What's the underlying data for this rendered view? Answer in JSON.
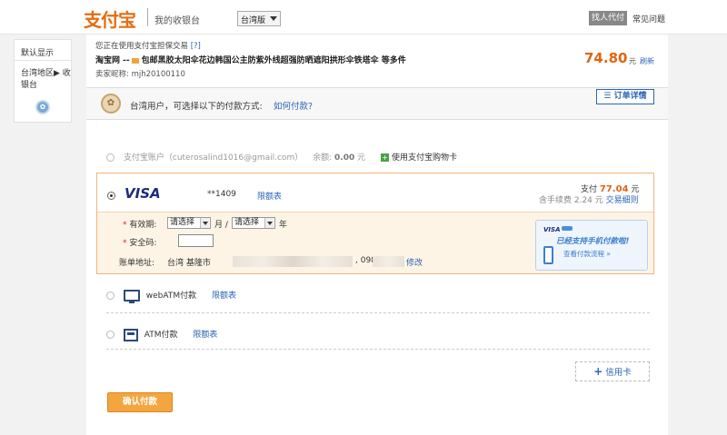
{
  "header": {
    "logo": "支付宝",
    "cashier_title": "我的收银台",
    "region": "台湾版",
    "find_pay": "找人代付",
    "faq": "常见问题"
  },
  "sidebar": {
    "title": "默认显示",
    "region_label": "台湾地区▶ 收银台"
  },
  "order": {
    "guarantee_notice": "您正在使用支付宝担保交易",
    "guarantee_q": "[?]",
    "site": "淘宝网 --",
    "title": "包邮黑胶太阳伞花边韩国公主防紫外线超强防晒遮阳拱形伞铁塔伞  等多件",
    "seller_label": "卖家昵称: ",
    "seller_name": "mjh20100110",
    "amount": "74.80",
    "amount_unit": "元",
    "refresh": "刷新"
  },
  "tip": {
    "text": "台湾用户，可选择以下的付款方式:",
    "link": "如何付款?",
    "order_detail": "订单详情"
  },
  "alipay_account": {
    "label": "支付宝账户（cuterosalind1016@gmail.com）",
    "balance_label": "余额:",
    "balance": "0.00",
    "balance_unit": "元",
    "cart_link": "使用支付宝购物卡"
  },
  "visa": {
    "brand": "VISA",
    "card_num": "**1409",
    "limit": "限额表",
    "pay_label": "支付",
    "pay_amount": "77.04",
    "pay_unit": "元",
    "fee_text": "含手续费 2.24 元",
    "fee_link": "交易细则",
    "expiry_label": "有效期:",
    "month_select": "请选择",
    "month_unit": "月 /",
    "year_select": "请选择",
    "year_unit": "年",
    "cvv_label": "安全码:",
    "billing_label": "账单地址:",
    "billing_value": "台湾 基隆市",
    "phone_prefix": ", 098.",
    "edit": "修改",
    "promo_brand": "VISA",
    "promo_title": "已经支持手机付款啦!",
    "promo_link": "查看付款流程 »"
  },
  "methods": [
    {
      "label": "webATM付款",
      "limit": "限额表"
    },
    {
      "label": "ATM付款",
      "limit": "限额表"
    }
  ],
  "add_card": "信用卡",
  "add_card_plus": "+",
  "confirm": "确认付款",
  "colors": {
    "accent": "#e06411",
    "link": "#2a66b5",
    "button": "#f3a640"
  }
}
